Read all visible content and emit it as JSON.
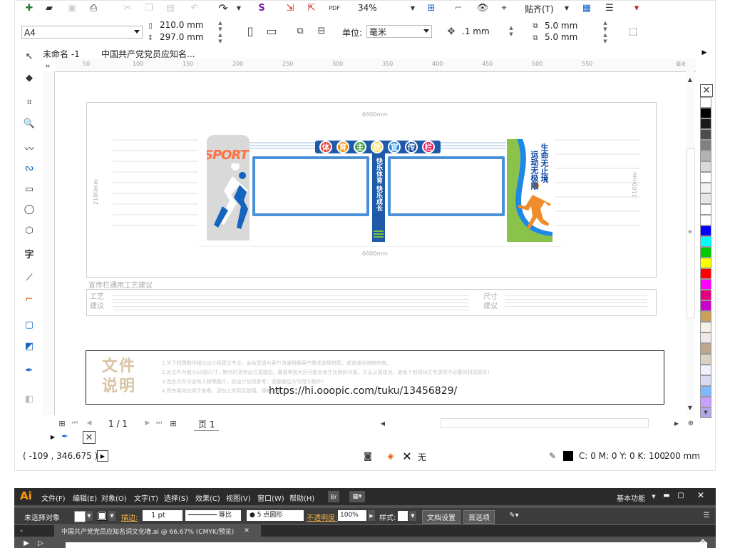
{
  "toolbar": {
    "zoom": "34%",
    "snap_label": "贴齐(T)",
    "page_size": "A4",
    "width": "210.0 mm",
    "height": "297.0 mm",
    "units_label": "单位:",
    "units_value": "毫米",
    "nudge": ".1 mm",
    "dup_x": "5.0 mm",
    "dup_y": "5.0 mm"
  },
  "doc_tabs": [
    "未命名 -1",
    "中国共产党党员应知名..."
  ],
  "ruler_ticks": [
    "50",
    "100",
    "150",
    "200",
    "250",
    "300",
    "350",
    "400",
    "450",
    "500",
    "550"
  ],
  "ruler_unit": "毫米",
  "artwork": {
    "top_dimension": "6600mm",
    "bottom_dimension": "6600mm",
    "side_dimension": "2100mm",
    "title_chars": [
      "体",
      "育",
      "主",
      "题",
      "宣",
      "传",
      "栏"
    ],
    "title_colors": [
      "#e53935",
      "#fb8c00",
      "#43a047",
      "#fdd835",
      "#1e88e5",
      "#0d47a1",
      "#e91e63"
    ],
    "sport_word": "SPORT",
    "center_pillar": "快乐体育 快乐成长",
    "slogan_1": "生命无止境",
    "slogan_2": "运动无极限",
    "craft_heading": "宣传栏通用工艺建议",
    "craft_label": "工艺建议",
    "size_label": "尺寸建议",
    "note_title": "文件说明",
    "note_lines": [
      "1.关于材质制作相比设计师建议专业，会给您请与客户沟通根据客户需求选择材质，或咨询当地制作商。",
      "2.此文件为缩小10倍尺寸，制作时请务必注意描边、蒙板等放大后可能会发生比例的问题，并无认真核对，避免个别项纠文字选项不必要的材质损失！",
      "3.若此文件中含有人物等图片，此设计仅供参考，请替换后方可用于制作！",
      "4.所有素材仅用于查看，请勿上传到互联网，侵权必究"
    ],
    "url": "https://hi.ooopic.com/tuku/13456829/"
  },
  "page_nav": {
    "counter": "1 / 1",
    "page_tab": "页 1"
  },
  "status": {
    "coords": "( -109 , 346.675 )",
    "fill_none": "无",
    "cmyk": "C: 0 M: 0 Y: 0 K: 100",
    "outline": ".200 mm"
  },
  "palette": [
    "#ffffff",
    "#000000",
    "#1a1a1a",
    "#4d4d4d",
    "#808080",
    "#b3b3b3",
    "#d9d9d9",
    "#ffffff",
    "#f2f2f2",
    "#e6e6e6",
    "#ffffff",
    "#ffffff",
    "#0000ff",
    "#00ffff",
    "#00cc00",
    "#ffff00",
    "#ff0000",
    "#ff00ff",
    "#e6007e",
    "#cc00cc",
    "#c8a058",
    "#f4f0e6",
    "#f2e6e6",
    "#bfa58c",
    "#d9d2c2",
    "#f0f0ff",
    "#d9d9f2",
    "#7fb8ff",
    "#c7a0ff",
    "#b3a6e6"
  ],
  "illustrator": {
    "logo": "Ai",
    "menu": [
      "文件(F)",
      "编辑(E)",
      "对象(O)",
      "文字(T)",
      "选择(S)",
      "效果(C)",
      "视图(V)",
      "窗口(W)",
      "帮助(H)"
    ],
    "workspace": "基本功能",
    "no_selection": "未选择对象",
    "stroke_label": "描边:",
    "stroke_value": "1 pt",
    "equal_ratio": "等比",
    "brush": "5 点圆形",
    "opacity_label": "不透明度:",
    "opacity_value": "100%",
    "style_label": "样式:",
    "doc_setup": "文档设置",
    "preferences": "首选项",
    "doc_tab": "中国共产党党员应知名词文化墙.ai @ 66.67% (CMYK/预览)"
  }
}
